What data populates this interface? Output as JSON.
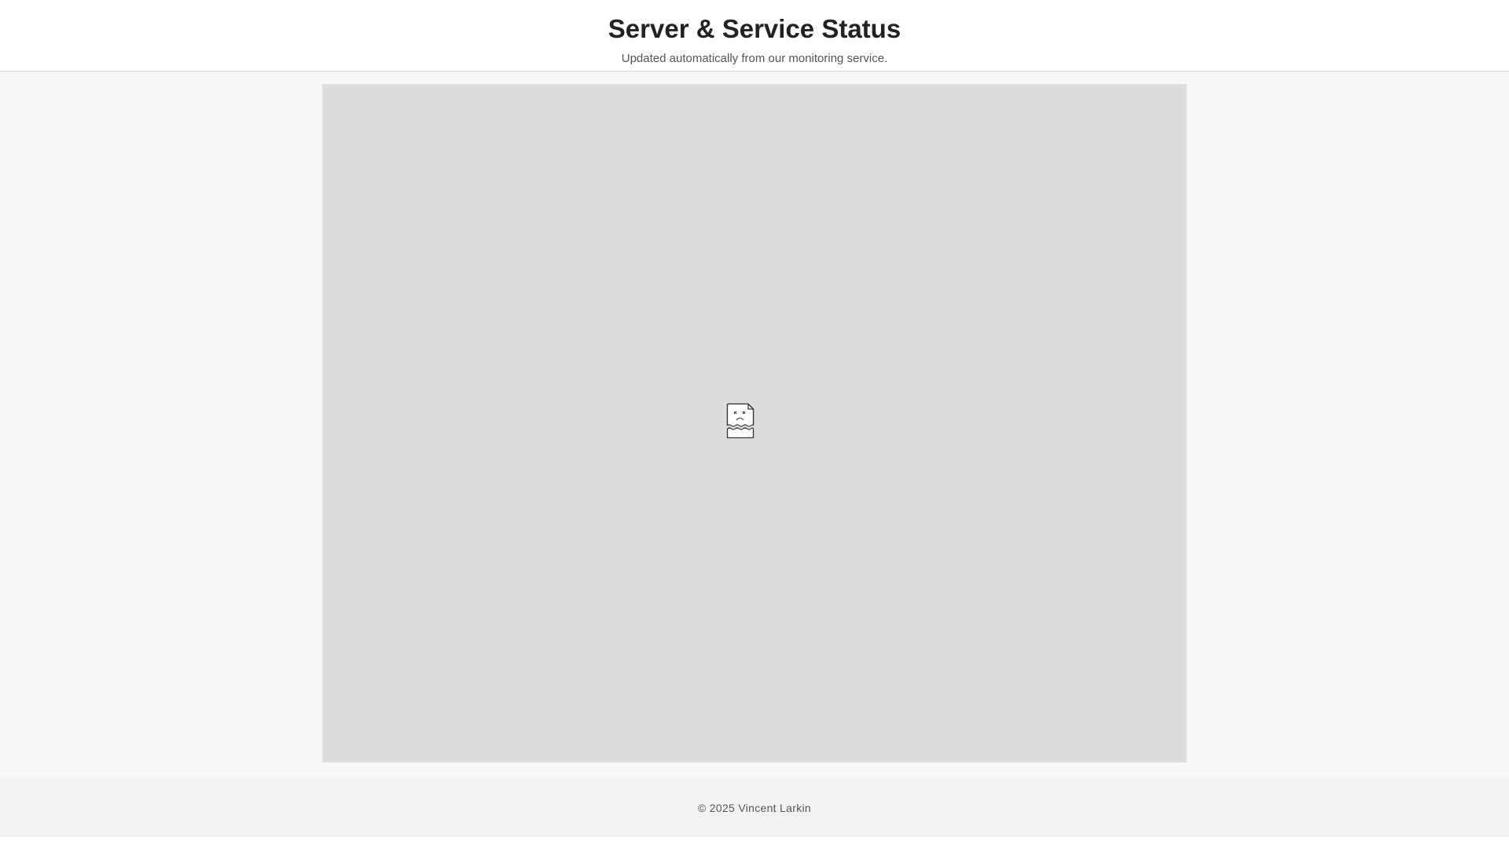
{
  "header": {
    "title": "Server & Service Status",
    "subtitle": "Updated automatically from our monitoring service."
  },
  "main": {
    "embed": {
      "state": "broken",
      "icon": "broken-document-icon"
    }
  },
  "footer": {
    "copyright": "© 2025 Vincent Larkin"
  },
  "colors": {
    "page_background": "#f7f7f7",
    "header_background": "#ffffff",
    "frame_background": "#dddddd",
    "footer_background": "#f2f2f2",
    "title_text": "#222222",
    "muted_text": "#555555"
  }
}
